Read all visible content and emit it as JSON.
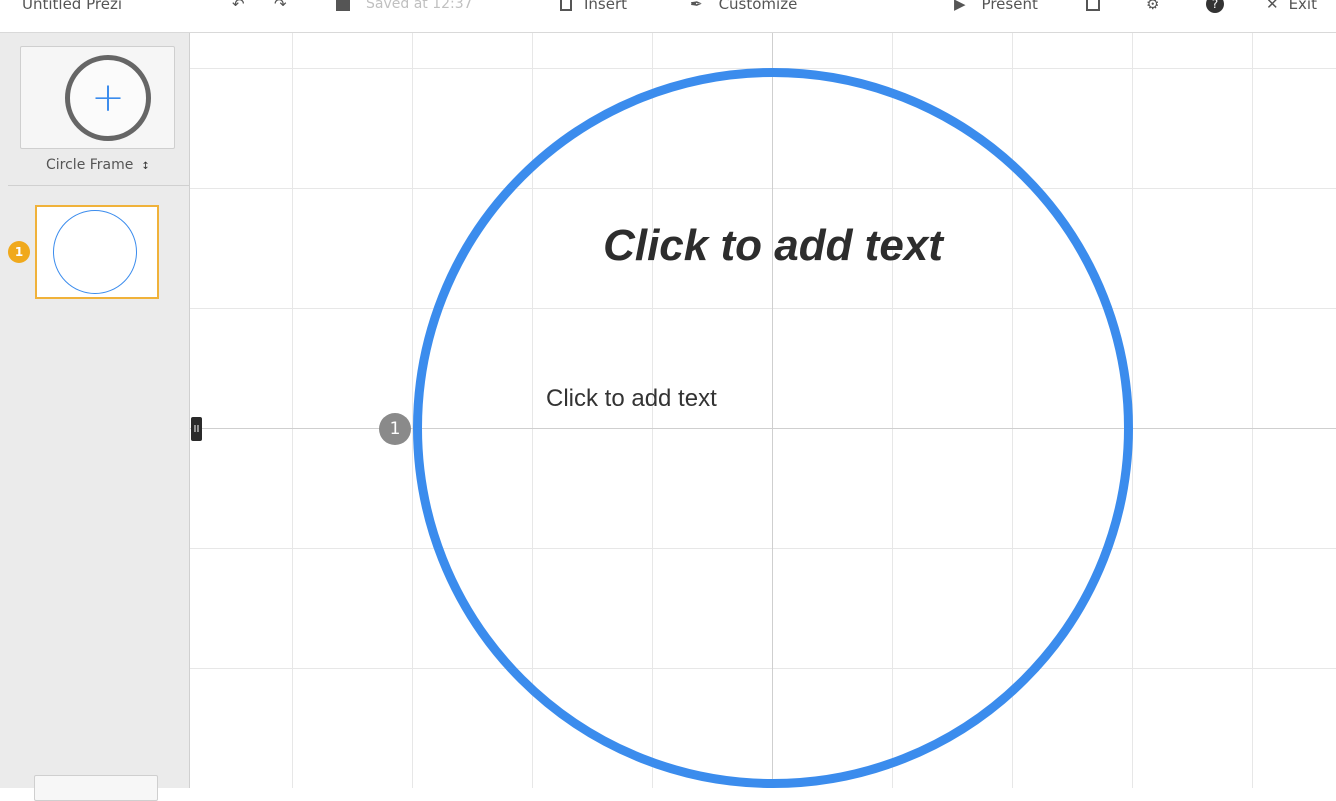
{
  "toolbar": {
    "title": "Untitled Prezi",
    "undo_icon": "undo-icon",
    "redo_icon": "redo-icon",
    "save_icon": "save-icon",
    "save_status": "Saved at 12:37",
    "insert_label": "Insert",
    "customize_label": "Customize",
    "present_label": "Present",
    "exit_label": "Exit",
    "accent_color": "#3b8ced"
  },
  "sidebar": {
    "frame_type": "Circle Frame",
    "add_icon": "plus-icon",
    "thumbnails": [
      {
        "number": "1"
      }
    ],
    "highlight_color": "#f0b23a"
  },
  "canvas": {
    "title_placeholder": "Click to add text",
    "body_placeholder": "Click to add text",
    "path_step": "1",
    "frame_color": "#3b8ced",
    "collapse_handle": "II"
  }
}
